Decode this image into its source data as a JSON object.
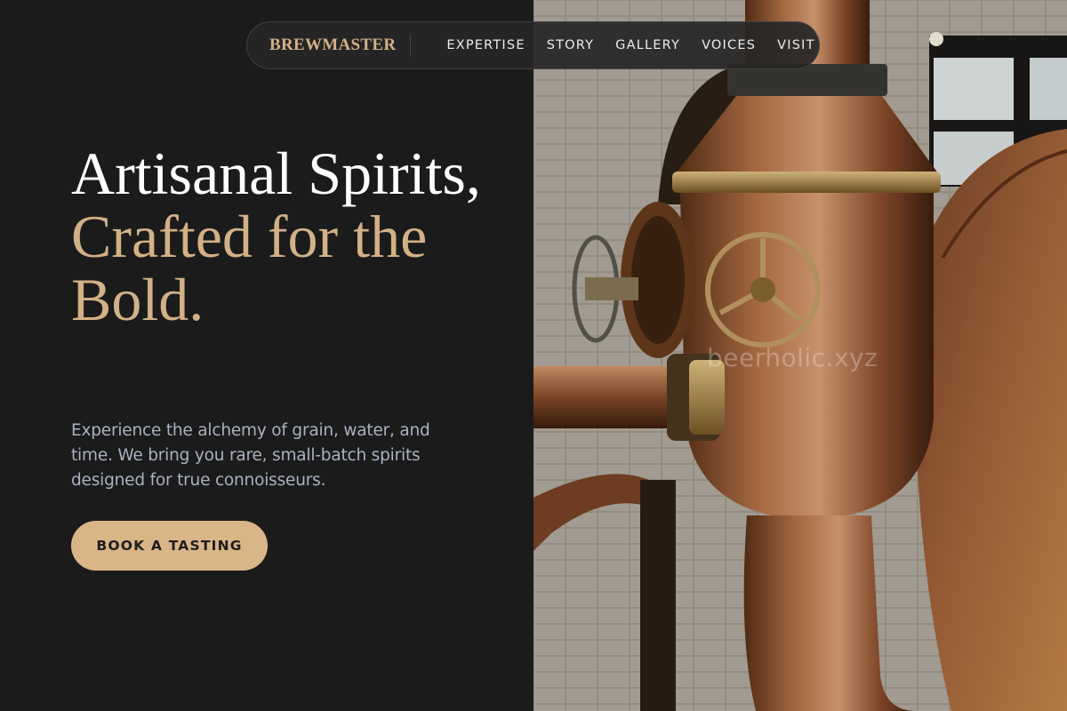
{
  "nav": {
    "brand": "BREWMASTER",
    "links": [
      "EXPERTISE",
      "STORY",
      "GALLERY",
      "VOICES",
      "VISIT"
    ]
  },
  "hero": {
    "title_line1": "Artisanal Spirits,",
    "title_accent": "Crafted for the Bold.",
    "subtitle": "Experience the alchemy of grain, water, and time. We bring you rare, small-batch spirits designed for true connoisseurs.",
    "cta_label": "BOOK A TASTING"
  },
  "image": {
    "watermark": "beerholic.xyz",
    "subject": "copper-still-photo"
  },
  "colors": {
    "background": "#1b1b1b",
    "accent": "#d2b186",
    "button": "#d9b587",
    "body_text": "#a9b2c0",
    "copper": "#b87a4a"
  }
}
